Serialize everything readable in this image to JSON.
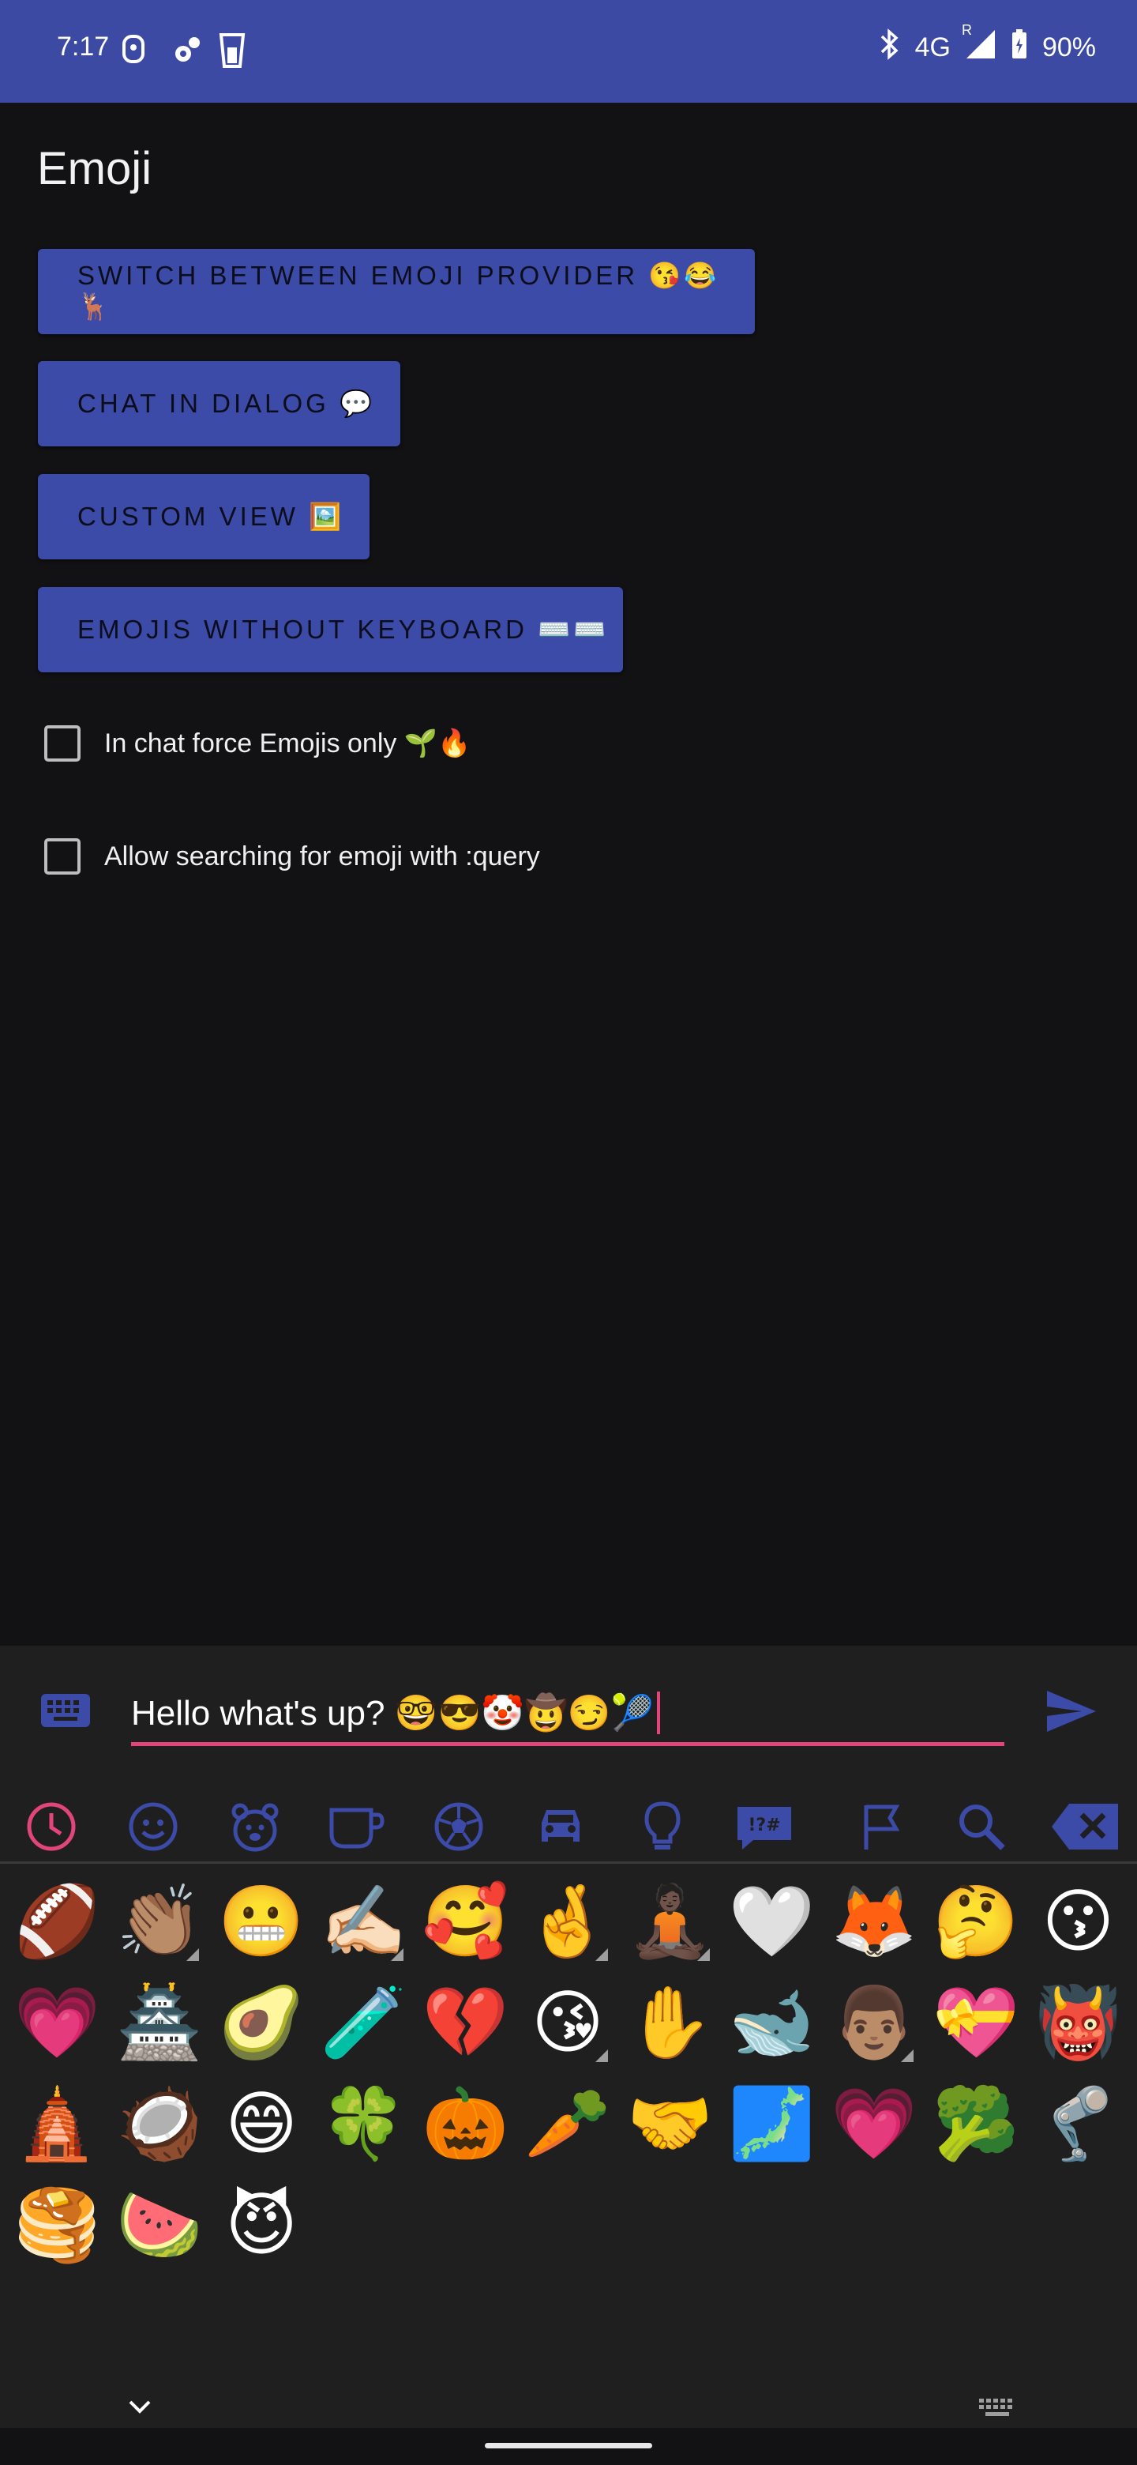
{
  "status_bar": {
    "time": "7:17",
    "network": "4G",
    "roaming": "R",
    "battery": "90%"
  },
  "app": {
    "title": "Emoji",
    "buttons": [
      {
        "label": "SWITCH BETWEEN EMOJI PROVIDER 😘😂🦌"
      },
      {
        "label": "CHAT IN DIALOG 💬"
      },
      {
        "label": "CUSTOM VIEW 🖼️"
      },
      {
        "label": "EMOJIS WITHOUT KEYBOARD ⌨️⌨️"
      }
    ],
    "checkboxes": [
      {
        "label": "In chat force Emojis only 🌱🔥",
        "checked": false
      },
      {
        "label": "Allow searching for emoji with :query",
        "checked": false
      }
    ]
  },
  "chat": {
    "input_value": "Hello what's up? 🤓😎🤡🤠😏🎾"
  },
  "emoji_categories": [
    "recent-icon",
    "smiley-icon",
    "bear-icon",
    "cup-icon",
    "soccer-ball-icon",
    "car-icon",
    "lightbulb-icon",
    "symbols-icon",
    "flag-icon",
    "search-icon",
    "backspace-icon"
  ],
  "emoji_grid": [
    "🏈",
    "👏🏽",
    "😬",
    "✍🏻",
    "🥰",
    "🤞",
    "🧘🏿",
    "🤍",
    "🦊",
    "🤔",
    "😗",
    "💗",
    "🏯",
    "🥑",
    "🧪",
    "💔",
    "😘",
    "✋",
    "🐋",
    "👨🏽",
    "💝",
    "👹",
    "🛕",
    "🥥",
    "😄",
    "🍀",
    "🎃",
    "🥕",
    "🤝",
    "🗾",
    "💗",
    "🥦",
    "🦿",
    "🥞",
    "🍉",
    "😈"
  ],
  "colors": {
    "accent": "#3c4aa8",
    "underline": "#e2457c",
    "background": "#121113",
    "panel": "#1f1f1f"
  }
}
